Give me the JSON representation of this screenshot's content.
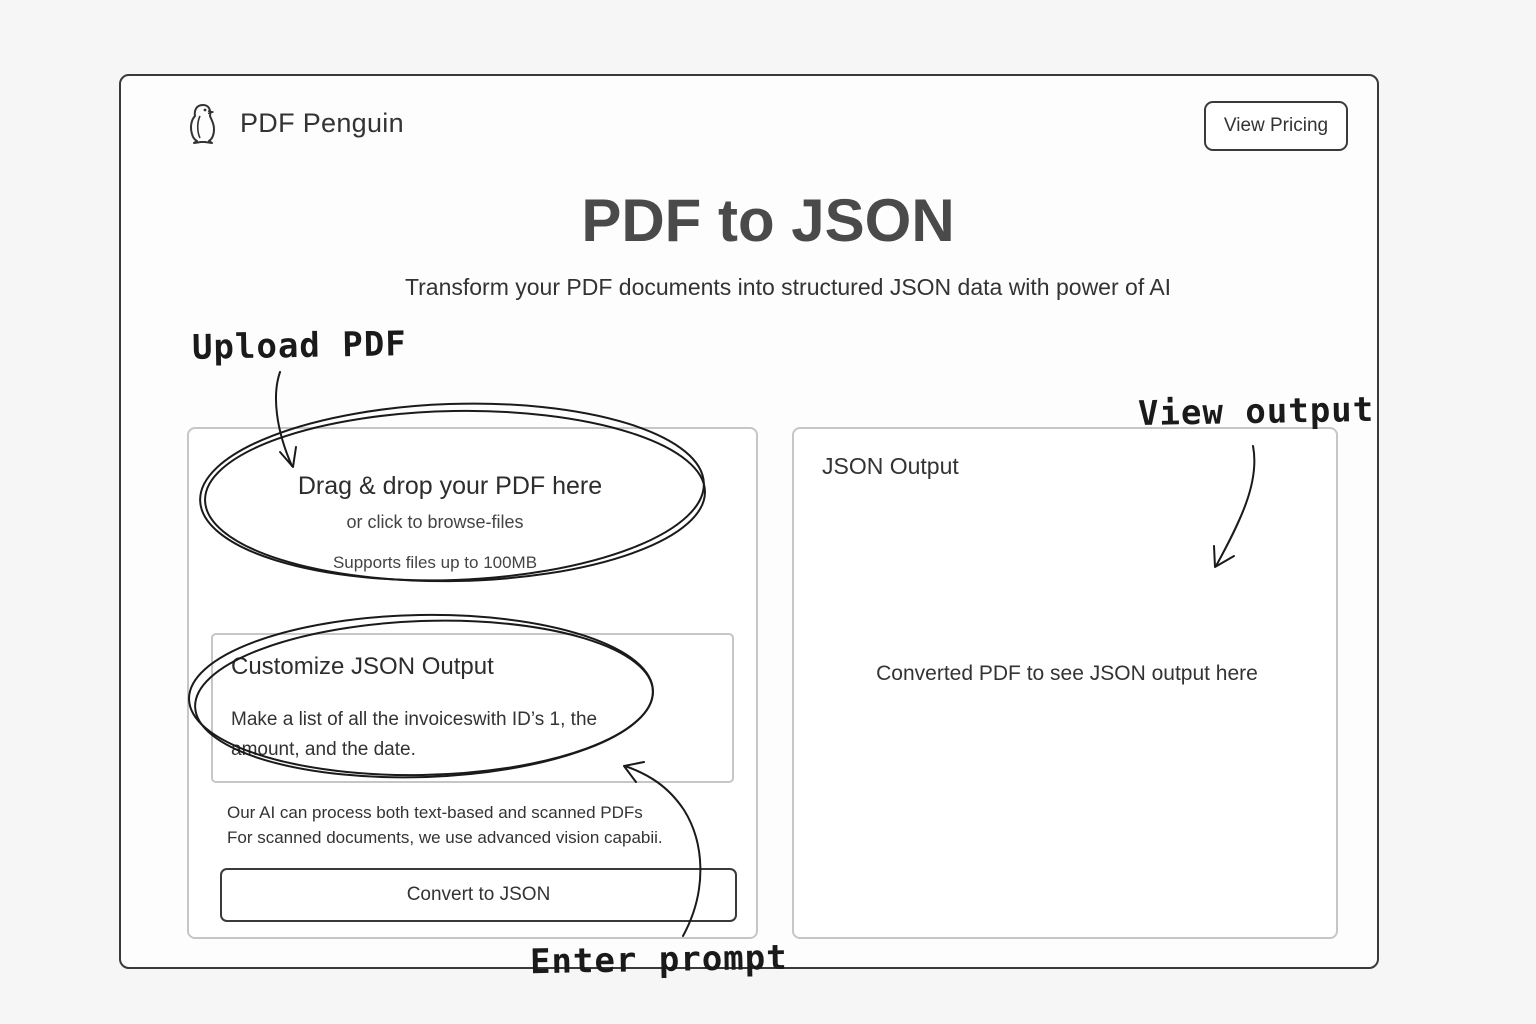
{
  "app": {
    "name": "PDF Penguin",
    "logo_icon": "penguin-icon"
  },
  "header": {
    "pricing_label": "View Pricing"
  },
  "hero": {
    "title": "PDF to JSON",
    "subtitle": "Transform your PDF documents into structured JSON data with power of AI"
  },
  "upload": {
    "title": "Drag & drop your PDF here",
    "subtitle": "or click to browse-files",
    "limit": "Supports files up to 100MB"
  },
  "customize": {
    "title": "Customize JSON Output",
    "prompt_line1": "Make a list of all the invoiceswith ID’s 1, the",
    "prompt_line2": "amount, and the date."
  },
  "note": {
    "line1": "Our AI can process both text-based and scanned PDFs",
    "line2": "For scanned documents, we use advanced vision capabii."
  },
  "actions": {
    "convert_label": "Convert to JSON"
  },
  "output": {
    "title": "JSON Output",
    "placeholder": "Converted PDF to see JSON output here"
  },
  "annotations": {
    "upload": "Upload PDF",
    "view": "View output",
    "prompt": "Enter prompt"
  },
  "colors": {
    "frame_border": "#3a3a3a",
    "panel_border": "#c6c6c6",
    "title_text": "#4a4a4a",
    "background": "#f6f6f6"
  }
}
